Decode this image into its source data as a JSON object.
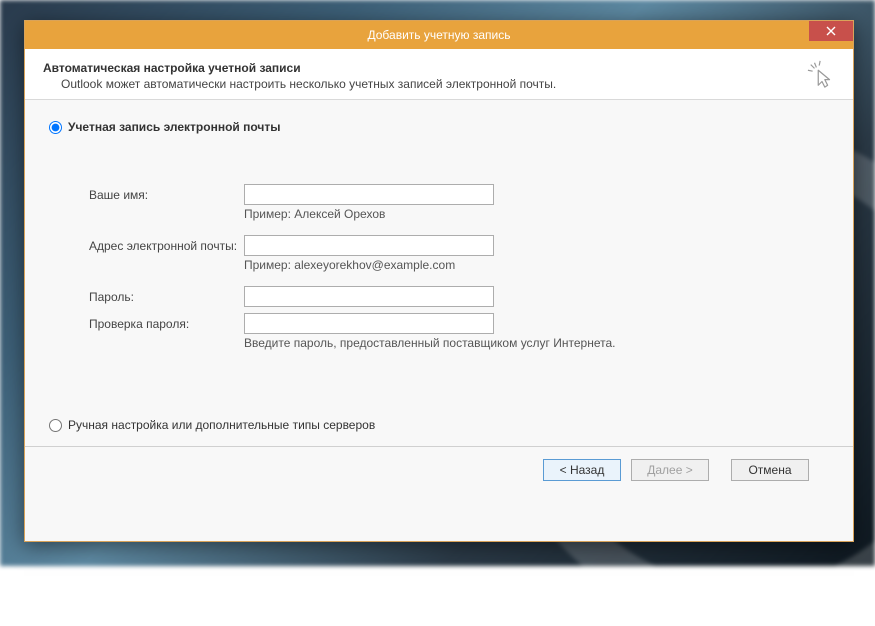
{
  "window": {
    "title": "Добавить учетную запись"
  },
  "header": {
    "title": "Автоматическая настройка учетной записи",
    "subtitle": "Outlook может автоматически настроить несколько учетных записей электронной почты."
  },
  "options": {
    "email_account": "Учетная запись электронной почты",
    "manual": "Ручная настройка или дополнительные типы серверов"
  },
  "fields": {
    "name": {
      "label": "Ваше имя:",
      "example": "Пример: Алексей Орехов",
      "value": ""
    },
    "email": {
      "label": "Адрес электронной почты:",
      "example": "Пример: alexeyorekhov@example.com",
      "value": ""
    },
    "password": {
      "label": "Пароль:",
      "value": ""
    },
    "password_confirm": {
      "label": "Проверка пароля:",
      "value": ""
    },
    "password_hint": "Введите пароль, предоставленный поставщиком услуг Интернета."
  },
  "buttons": {
    "back": "< Назад",
    "next": "Далее >",
    "cancel": "Отмена"
  }
}
